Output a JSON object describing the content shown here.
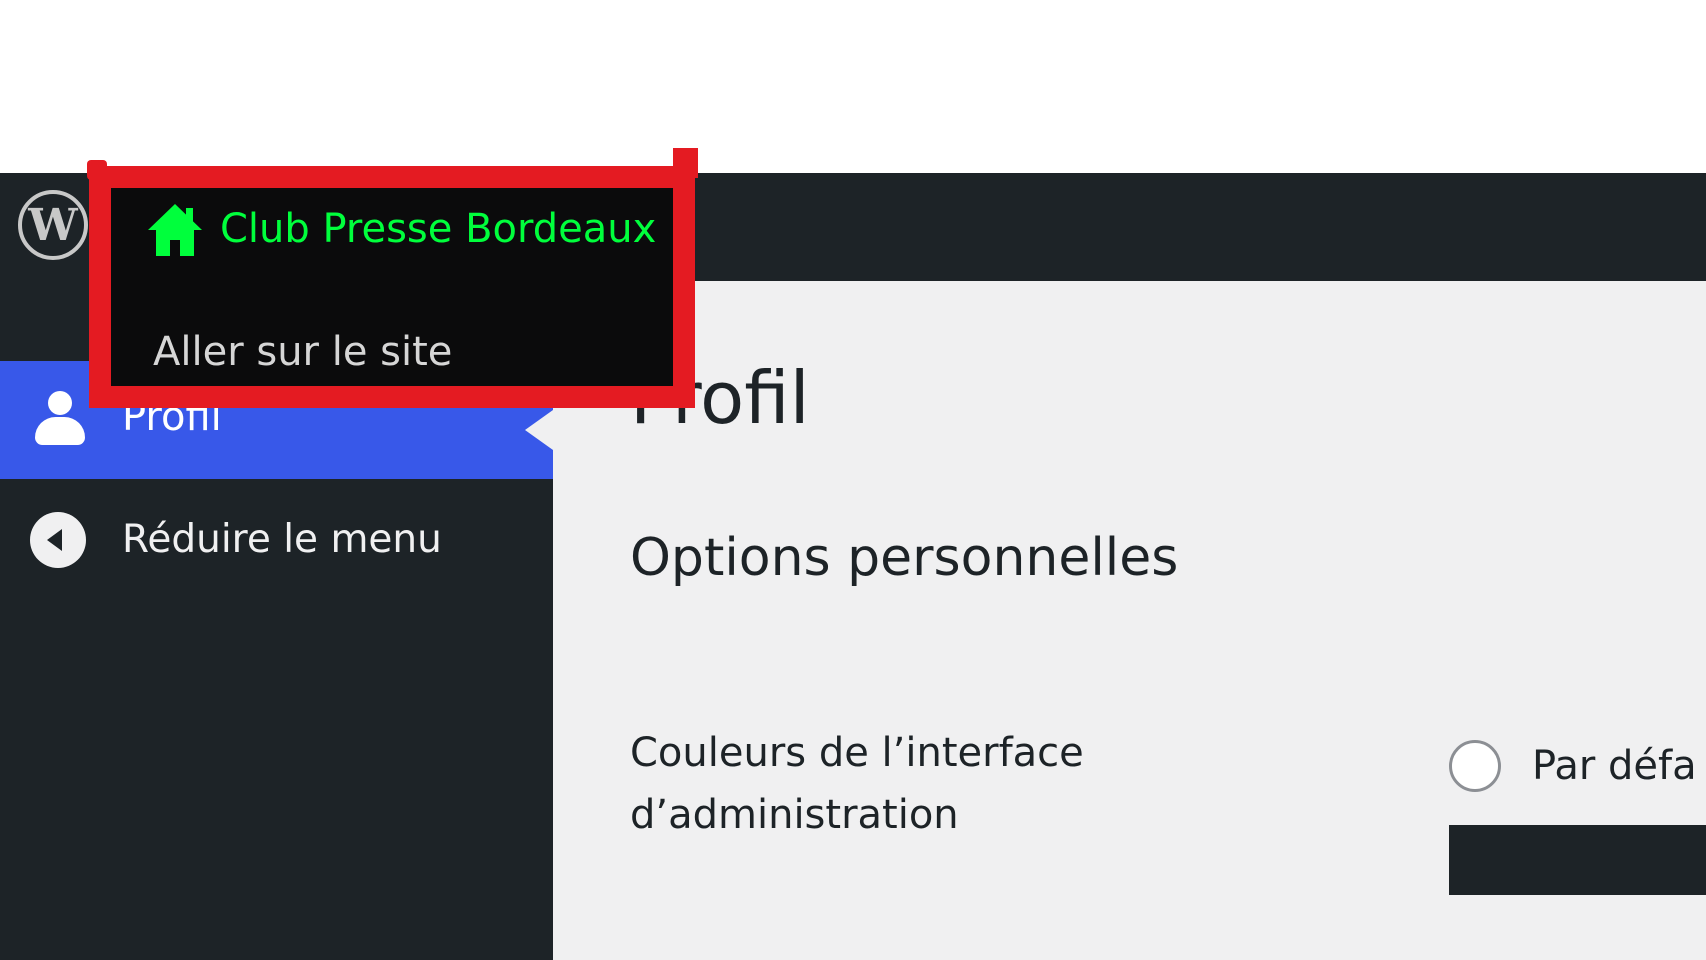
{
  "colors": {
    "admin_bar": "#1d2327",
    "menu_active": "#3858e9",
    "content_bg": "#f0f0f1",
    "highlight_border": "#e41b22",
    "site_name": "#00ff3c"
  },
  "admin_bar": {
    "logo_icon": "wordpress-logo-icon",
    "logo_glyph": "W",
    "site_menu": {
      "site_name": "Club Presse Bordeaux",
      "site_icon": "home-icon",
      "visit_site_label": "Aller sur le site"
    }
  },
  "sidebar": {
    "items": [
      {
        "label": "Profil",
        "icon": "user-icon",
        "active": true
      },
      {
        "label": "Réduire le menu",
        "icon": "collapse-arrow-icon",
        "active": false
      }
    ]
  },
  "main": {
    "page_title": "Profil",
    "section_title": "Options personnelles",
    "admin_color": {
      "label": "Couleurs de l’interface d’administration",
      "option_label": "Par défa"
    }
  }
}
